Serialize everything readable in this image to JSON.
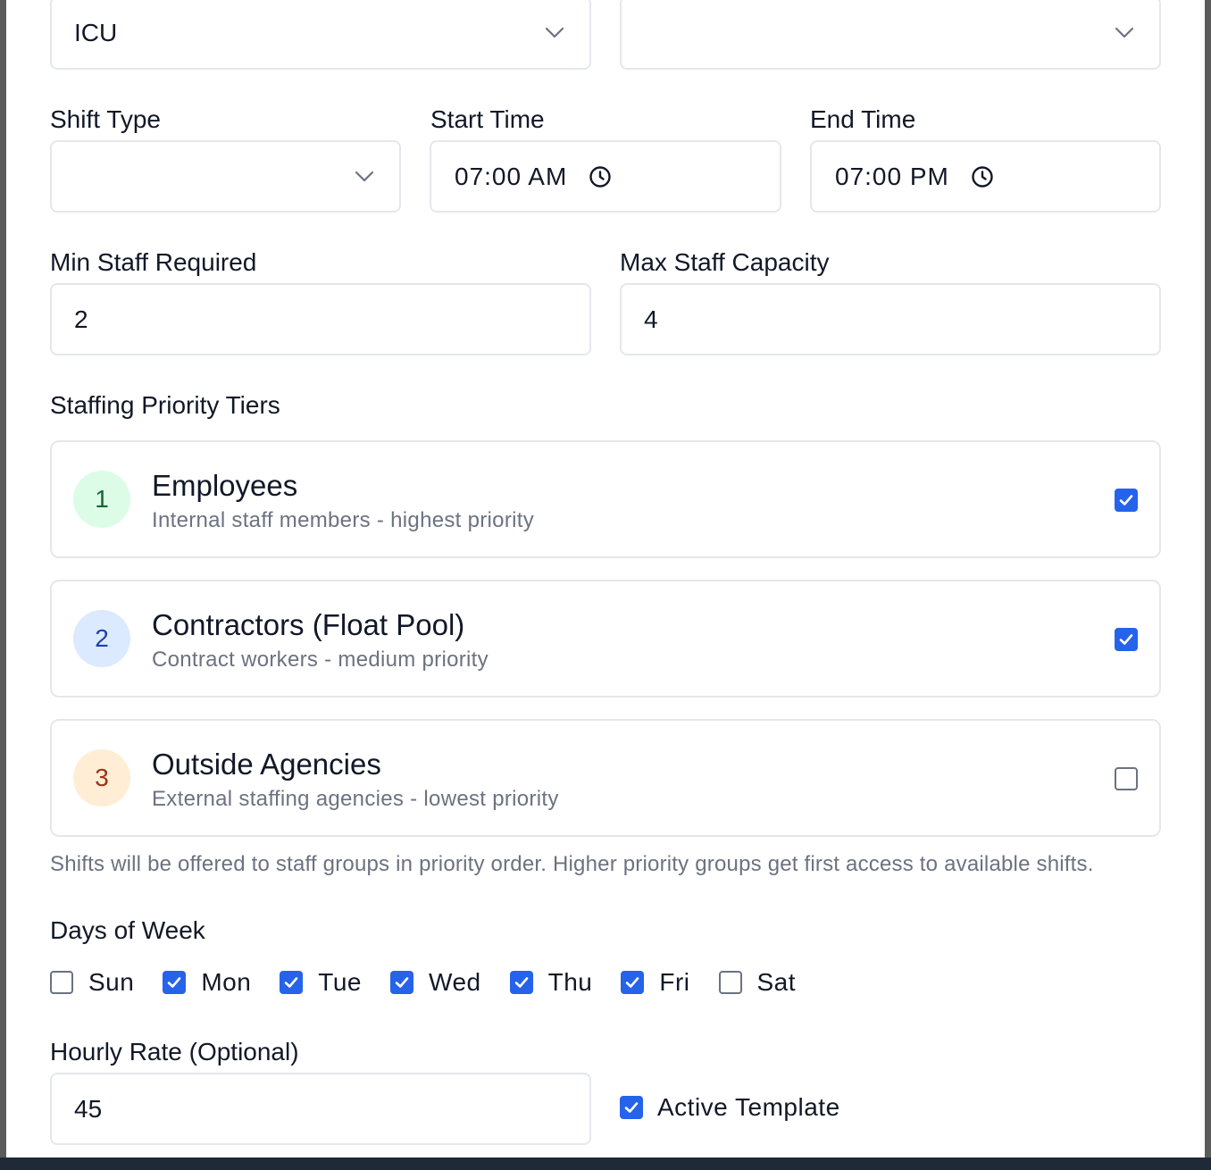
{
  "department": {
    "value": "ICU"
  },
  "second_select": {
    "value": ""
  },
  "shift_type": {
    "label": "Shift Type",
    "value": ""
  },
  "start_time": {
    "label": "Start Time",
    "value": "07:00 AM"
  },
  "end_time": {
    "label": "End Time",
    "value": "07:00 PM"
  },
  "min_staff": {
    "label": "Min Staff Required",
    "value": "2"
  },
  "max_staff": {
    "label": "Max Staff Capacity",
    "value": "4"
  },
  "tiers": {
    "heading": "Staffing Priority Tiers",
    "items": [
      {
        "rank": "1",
        "title": "Employees",
        "description": "Internal staff members - highest priority",
        "checked": true,
        "badge_bg": "#dcfce7",
        "badge_fg": "#166534"
      },
      {
        "rank": "2",
        "title": "Contractors (Float Pool)",
        "description": "Contract workers - medium priority",
        "checked": true,
        "badge_bg": "#dbeafe",
        "badge_fg": "#1e40af"
      },
      {
        "rank": "3",
        "title": "Outside Agencies",
        "description": "External staffing agencies - lowest priority",
        "checked": false,
        "badge_bg": "#ffedd5",
        "badge_fg": "#9a3412"
      }
    ],
    "note": "Shifts will be offered to staff groups in priority order. Higher priority groups get first access to available shifts."
  },
  "days_of_week": {
    "label": "Days of Week",
    "days": [
      {
        "label": "Sun",
        "checked": false
      },
      {
        "label": "Mon",
        "checked": true
      },
      {
        "label": "Tue",
        "checked": true
      },
      {
        "label": "Wed",
        "checked": true
      },
      {
        "label": "Thu",
        "checked": true
      },
      {
        "label": "Fri",
        "checked": true
      },
      {
        "label": "Sat",
        "checked": false
      }
    ]
  },
  "hourly_rate": {
    "label": "Hourly Rate (Optional)",
    "value": "45"
  },
  "active_template": {
    "label": "Active Template",
    "checked": true
  },
  "colors": {
    "accent": "#2563eb",
    "border": "#e5e7eb",
    "muted_text": "#6b7280"
  }
}
